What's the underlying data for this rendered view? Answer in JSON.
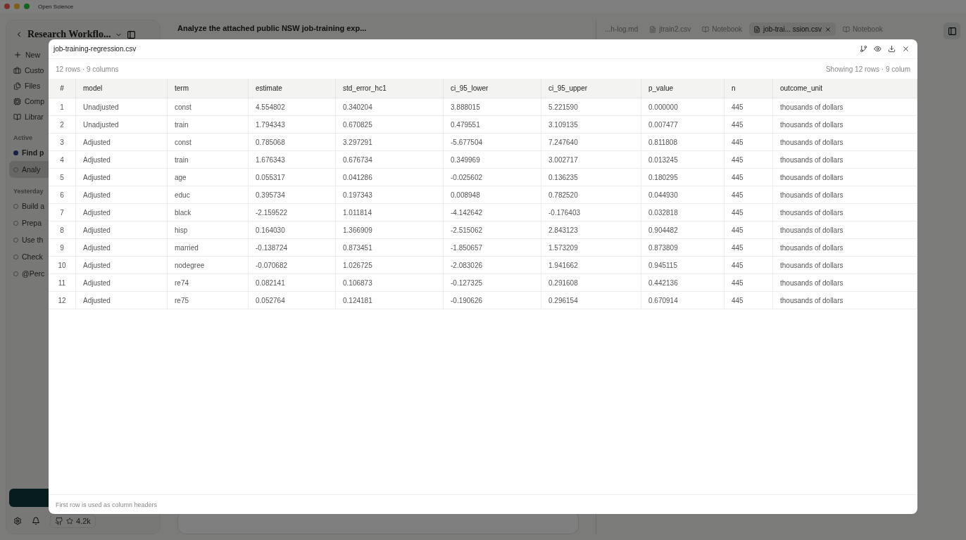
{
  "window": {
    "title": "Open Science"
  },
  "sidebar": {
    "title": "Research Workflo...",
    "new_label": "New",
    "nav": [
      {
        "label": "Custo",
        "kind": "briefcase"
      },
      {
        "label": "Files",
        "kind": "files"
      },
      {
        "label": "Comp",
        "kind": "compute"
      },
      {
        "label": "Librar",
        "kind": "library"
      }
    ],
    "sections": [
      {
        "heading": "Active",
        "items": [
          {
            "label": "Find p",
            "running": true,
            "selected": false
          },
          {
            "label": "Analy",
            "running": false,
            "selected": true
          }
        ]
      },
      {
        "heading": "Yesterday",
        "items": [
          {
            "label": "Build a",
            "running": false,
            "selected": false
          },
          {
            "label": "Prepa",
            "running": false,
            "selected": false
          },
          {
            "label": "Use th",
            "running": false,
            "selected": false
          },
          {
            "label": "Check",
            "running": false,
            "selected": false
          },
          {
            "label": "@Perc",
            "running": false,
            "selected": false
          }
        ]
      }
    ],
    "stars": "4.2k"
  },
  "chat": {
    "title": "Analyze the attached public NSW job-training exp..."
  },
  "tabs": [
    {
      "label": "...h-log.md",
      "kind": "none",
      "selected": false
    },
    {
      "label": "jtrain2.csv",
      "kind": "file",
      "selected": false
    },
    {
      "label": "Notebook",
      "kind": "book",
      "selected": false
    },
    {
      "label": "job-trai... ssion.csv",
      "kind": "file",
      "selected": true
    },
    {
      "label": "Notebook",
      "kind": "book",
      "selected": false
    }
  ],
  "dialog": {
    "title": "job-training-regression.csv",
    "summary": "12 rows · 9 columns",
    "showing": "Showing 12 rows · 9 colum",
    "columns": [
      "#",
      "model",
      "term",
      "estimate",
      "std_error_hc1",
      "ci_95_lower",
      "ci_95_upper",
      "p_value",
      "n",
      "outcome_unit"
    ],
    "rows": [
      [
        "1",
        "Unadjusted",
        "const",
        "4.554802",
        "0.340204",
        "3.888015",
        "5.221590",
        "0.000000",
        "445",
        "thousands of dollars"
      ],
      [
        "2",
        "Unadjusted",
        "train",
        "1.794343",
        "0.670825",
        "0.479551",
        "3.109135",
        "0.007477",
        "445",
        "thousands of dollars"
      ],
      [
        "3",
        "Adjusted",
        "const",
        "0.785068",
        "3.297291",
        "-5.677504",
        "7.247640",
        "0.811808",
        "445",
        "thousands of dollars"
      ],
      [
        "4",
        "Adjusted",
        "train",
        "1.676343",
        "0.676734",
        "0.349969",
        "3.002717",
        "0.013245",
        "445",
        "thousands of dollars"
      ],
      [
        "5",
        "Adjusted",
        "age",
        "0.055317",
        "0.041286",
        "-0.025602",
        "0.136235",
        "0.180295",
        "445",
        "thousands of dollars"
      ],
      [
        "6",
        "Adjusted",
        "educ",
        "0.395734",
        "0.197343",
        "0.008948",
        "0.782520",
        "0.044930",
        "445",
        "thousands of dollars"
      ],
      [
        "7",
        "Adjusted",
        "black",
        "-2.159522",
        "1.011814",
        "-4.142642",
        "-0.176403",
        "0.032818",
        "445",
        "thousands of dollars"
      ],
      [
        "8",
        "Adjusted",
        "hisp",
        "0.164030",
        "1.366909",
        "-2.515062",
        "2.843123",
        "0.904482",
        "445",
        "thousands of dollars"
      ],
      [
        "9",
        "Adjusted",
        "married",
        "-0.138724",
        "0.873451",
        "-1.850657",
        "1.573209",
        "0.873809",
        "445",
        "thousands of dollars"
      ],
      [
        "10",
        "Adjusted",
        "nodegree",
        "-0.070682",
        "1.026725",
        "-2.083026",
        "1.941662",
        "0.945115",
        "445",
        "thousands of dollars"
      ],
      [
        "11",
        "Adjusted",
        "re74",
        "0.082141",
        "0.106873",
        "-0.127325",
        "0.291608",
        "0.442136",
        "445",
        "thousands of dollars"
      ],
      [
        "12",
        "Adjusted",
        "re75",
        "0.052764",
        "0.124181",
        "-0.190626",
        "0.296154",
        "0.670914",
        "445",
        "thousands of dollars"
      ]
    ],
    "footer": "First row is used as column headers"
  }
}
